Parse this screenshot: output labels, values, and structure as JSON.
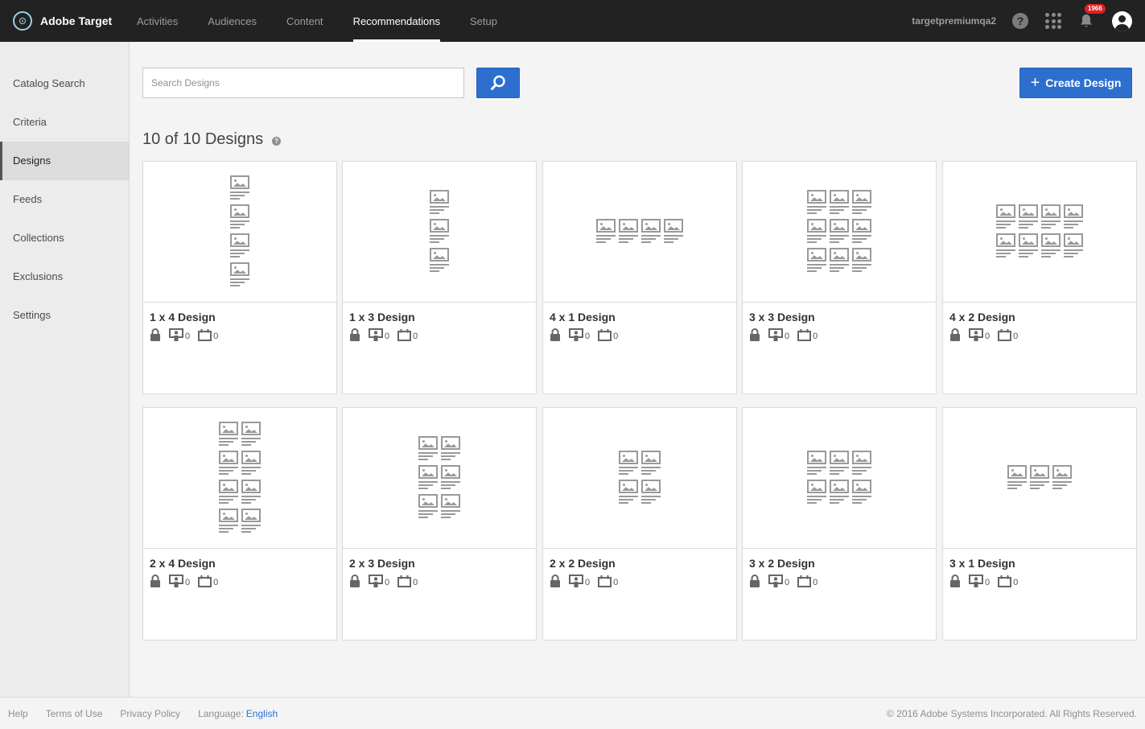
{
  "app": {
    "title": "Adobe Target"
  },
  "nav": [
    {
      "label": "Activities",
      "active": false
    },
    {
      "label": "Audiences",
      "active": false
    },
    {
      "label": "Content",
      "active": false
    },
    {
      "label": "Recommendations",
      "active": true
    },
    {
      "label": "Setup",
      "active": false
    }
  ],
  "header": {
    "username": "targetpremiumqa2",
    "notification_count": "1966"
  },
  "sidebar": {
    "items": [
      {
        "label": "Catalog Search",
        "active": false
      },
      {
        "label": "Criteria",
        "active": false
      },
      {
        "label": "Designs",
        "active": true
      },
      {
        "label": "Feeds",
        "active": false
      },
      {
        "label": "Collections",
        "active": false
      },
      {
        "label": "Exclusions",
        "active": false
      },
      {
        "label": "Settings",
        "active": false
      }
    ]
  },
  "search": {
    "placeholder": "Search Designs"
  },
  "create_button": {
    "label": "Create Design"
  },
  "count_label": "10 of 10 Designs",
  "designs": [
    {
      "title": "1 x 4 Design",
      "cols": 1,
      "rows": 4,
      "activities": "0",
      "schedule": "0"
    },
    {
      "title": "1 x 3 Design",
      "cols": 1,
      "rows": 3,
      "activities": "0",
      "schedule": "0"
    },
    {
      "title": "4 x 1 Design",
      "cols": 4,
      "rows": 1,
      "activities": "0",
      "schedule": "0"
    },
    {
      "title": "3 x 3 Design",
      "cols": 3,
      "rows": 3,
      "activities": "0",
      "schedule": "0"
    },
    {
      "title": "4 x 2 Design",
      "cols": 4,
      "rows": 2,
      "activities": "0",
      "schedule": "0"
    },
    {
      "title": "2 x 4 Design",
      "cols": 2,
      "rows": 4,
      "activities": "0",
      "schedule": "0"
    },
    {
      "title": "2 x 3 Design",
      "cols": 2,
      "rows": 3,
      "activities": "0",
      "schedule": "0"
    },
    {
      "title": "2 x 2 Design",
      "cols": 2,
      "rows": 2,
      "activities": "0",
      "schedule": "0"
    },
    {
      "title": "3 x 2 Design",
      "cols": 3,
      "rows": 2,
      "activities": "0",
      "schedule": "0"
    },
    {
      "title": "3 x 1 Design",
      "cols": 3,
      "rows": 1,
      "activities": "0",
      "schedule": "0"
    }
  ],
  "footer": {
    "links": [
      "Help",
      "Terms of Use",
      "Privacy Policy"
    ],
    "language_label": "Language:",
    "language_value": "English",
    "copyright": "© 2016 Adobe Systems Incorporated. All Rights Reserved."
  },
  "colors": {
    "accent": "#2d6fcf",
    "topbar": "#222222",
    "badge": "#e02020"
  }
}
